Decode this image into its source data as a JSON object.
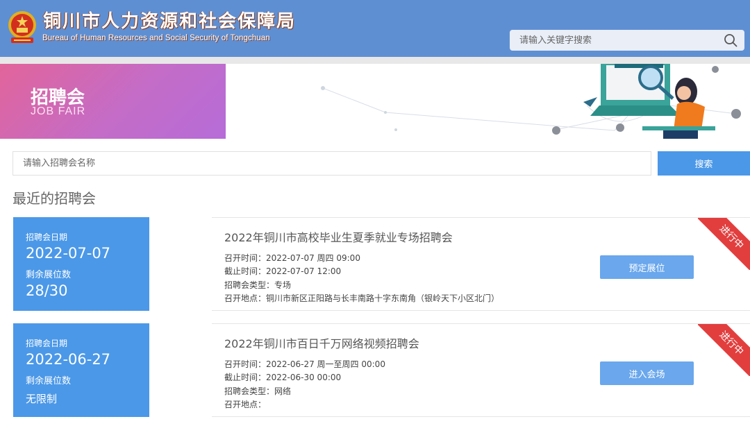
{
  "header": {
    "title": "铜川市人力资源和社会保障局",
    "subtitle": "Bureau of Human Resources and Social Security of Tongchuan",
    "search_placeholder": "请输入关键字搜索",
    "icons": {
      "emblem": "national-emblem-icon",
      "search": "search-icon"
    }
  },
  "banner": {
    "title": "招聘会",
    "subtitle": "JOB FAIR"
  },
  "filter": {
    "placeholder": "请输入招聘会名称",
    "button": "搜索"
  },
  "section_title": "最近的招聘会",
  "events": [
    {
      "date_label": "招聘会日期",
      "date": "2022-07-07",
      "seats_label": "剩余展位数",
      "seats": "28/30",
      "title": "2022年铜川市高校毕业生夏季就业专场招聘会",
      "start": "召开时间：2022-07-07 周四  09:00",
      "deadline": "截止时间：2022-07-07 12:00",
      "type": "招聘会类型：专场",
      "location": "召开地点：铜川市新区正阳路与长丰南路十字东南角（银岭天下小区北门）",
      "button": "预定展位",
      "status": "进行中"
    },
    {
      "date_label": "招聘会日期",
      "date": "2022-06-27",
      "seats_label": "剩余展位数",
      "seats": "无限制",
      "title": "2022年铜川市百日千万网络视频招聘会",
      "start": "召开时间：2022-06-27 周一至周四  00:00",
      "deadline": "截止时间：2022-06-30 00:00",
      "type": "招聘会类型：网络",
      "location": "召开地点：",
      "button": "进入会场",
      "status": "进行中"
    }
  ],
  "colors": {
    "header": "#5f8fd3",
    "accent": "#4b98e8",
    "ribbon": "#e23e3e"
  }
}
